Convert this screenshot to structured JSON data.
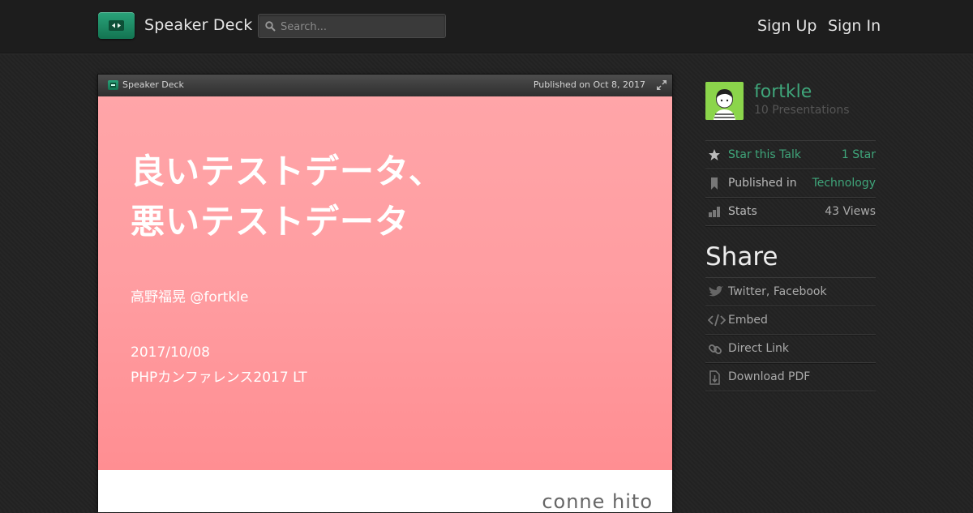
{
  "header": {
    "brand": "Speaker Deck",
    "search_placeholder": "Search...",
    "sign_up": "Sign Up",
    "sign_in": "Sign In"
  },
  "player": {
    "brand": "Speaker Deck",
    "published": "Published on Oct 8, 2017",
    "slide": {
      "title_line1": "良いテストデータ、",
      "title_line2": "悪いテストデータ",
      "author": "高野福晃 @fortkle",
      "date": "2017/10/08",
      "event": "PHPカンファレンス2017 LT",
      "footer_logo": "conne hito"
    }
  },
  "sidebar": {
    "owner_name": "fortkle",
    "owner_presentations": "10 Presentations",
    "star_label": "Star this Talk",
    "star_count": "1 Star",
    "published_label": "Published in",
    "published_category": "Technology",
    "stats_label": "Stats",
    "stats_views": "43 Views",
    "share_title": "Share",
    "share_items": [
      "Twitter, Facebook",
      "Embed",
      "Direct Link",
      "Download PDF"
    ]
  },
  "colors": {
    "accent": "#3fa57a",
    "slide_pink": "#ff9da1",
    "background": "#232323"
  }
}
